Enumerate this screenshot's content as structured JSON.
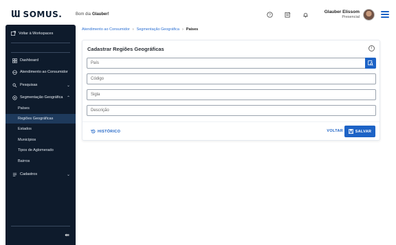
{
  "brand": {
    "mark": "Ɯ",
    "name": "SOMUS."
  },
  "greeting": {
    "prefix": "Bom dia",
    "name": "Glauber!"
  },
  "topbar": {
    "icons": [
      "help-icon",
      "checklist-icon",
      "bell-icon",
      "menu-icon"
    ]
  },
  "user": {
    "name": "Glauber Elissom",
    "role": "Presencial"
  },
  "sidebar": {
    "workspace_label": "Voltar à Workspaces",
    "items": [
      {
        "label": "Dashboard",
        "icon": "dashboard-icon"
      },
      {
        "label": "Atendimento ao Consumidor",
        "icon": "support-icon"
      },
      {
        "label": "Pesquisas",
        "icon": "search-list-icon"
      },
      {
        "label": "Segmentação Geográfica",
        "icon": "geo-icon"
      },
      {
        "label": "Cadastros",
        "icon": "register-icon"
      }
    ],
    "sub_items": [
      {
        "label": "Países"
      },
      {
        "label": "Regiões Geográficas"
      },
      {
        "label": "Estados"
      },
      {
        "label": "Municípios"
      },
      {
        "label": "Tipos de Aglomerado"
      },
      {
        "label": "Bairros"
      }
    ],
    "active_sub": "Regiões Geográficas"
  },
  "breadcrumb": [
    "Atendimento ao Consumidor",
    "Segmentação Geográfica",
    "Países"
  ],
  "form": {
    "title": "Cadastrar Regiões Geográficas",
    "fields": [
      {
        "placeholder": "País",
        "value": ""
      },
      {
        "placeholder": "Código",
        "value": ""
      },
      {
        "placeholder": "Sigla",
        "value": ""
      },
      {
        "placeholder": "Descrição",
        "value": ""
      }
    ],
    "history_label": "HISTÓRICO",
    "back_label": "VOLTAR",
    "save_label": "SALVAR"
  },
  "colors": {
    "primary": "#1d63c6",
    "sidebar_bg": "#0e1b2c",
    "sidebar_active": "#1e3a5c"
  }
}
